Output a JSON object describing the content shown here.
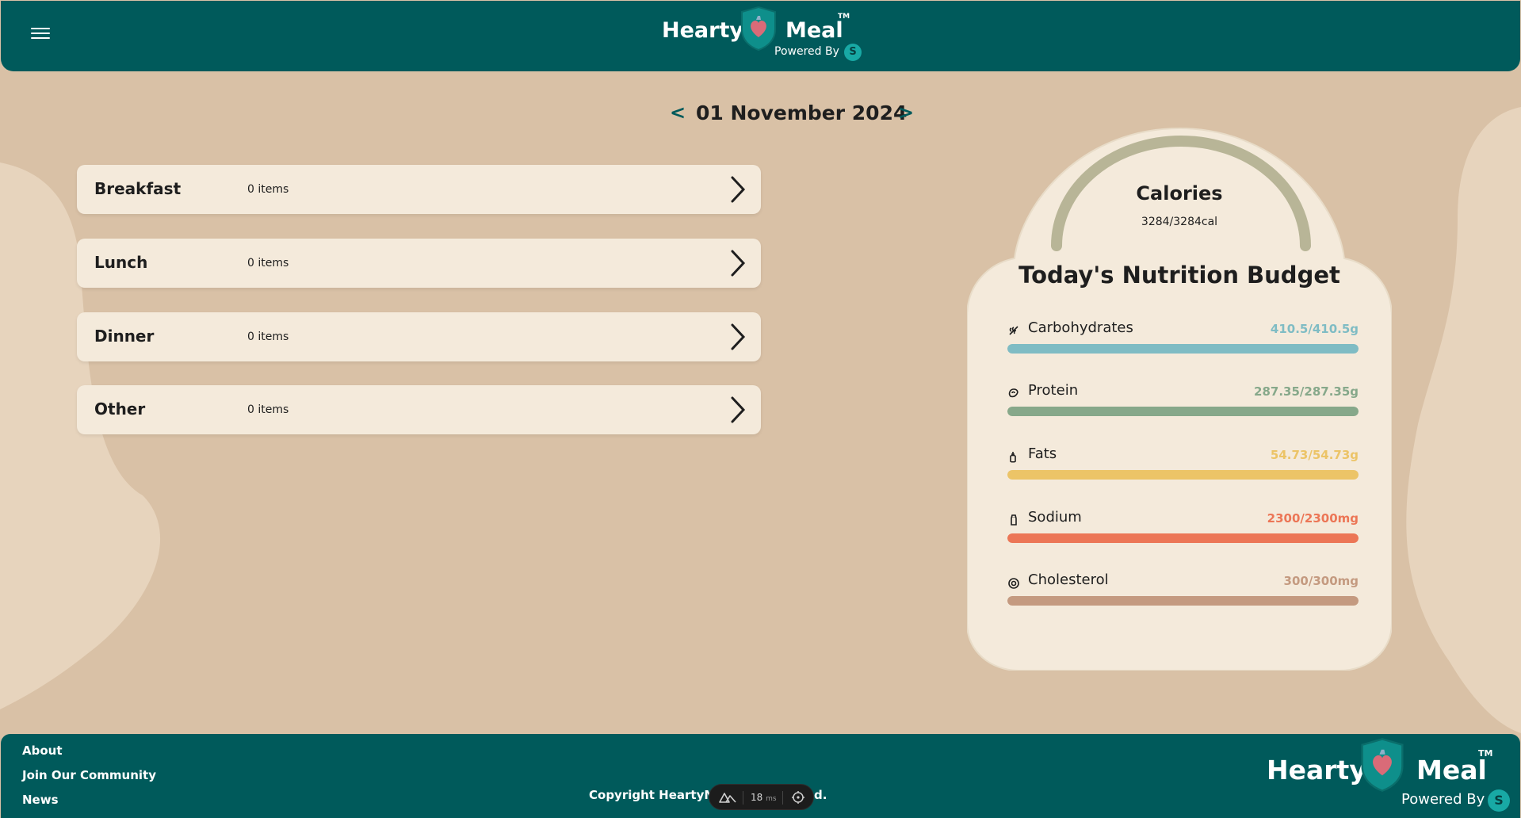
{
  "brand": {
    "word1": "Hearty",
    "word2": "Meal",
    "tm": "TM",
    "powered_by": "Powered By",
    "badge_letter": "S"
  },
  "date_nav": {
    "prev": "<",
    "date": "01 November 2024",
    "next": ">"
  },
  "meals": [
    {
      "name": "Breakfast",
      "count": "0 items"
    },
    {
      "name": "Lunch",
      "count": "0 items"
    },
    {
      "name": "Dinner",
      "count": "0 items"
    },
    {
      "name": "Other",
      "count": "0 items"
    }
  ],
  "calories": {
    "title": "Calories",
    "value": "3284/3284cal",
    "progress": 1.0
  },
  "budget": {
    "title": "Today's Nutrition Budget",
    "nutrients": [
      {
        "label": "Carbohydrates",
        "value": "410.5/410.5g",
        "progress": 1.0,
        "color": "#7fbcc4",
        "icon": "grain-icon"
      },
      {
        "label": "Protein",
        "value": "287.35/287.35g",
        "progress": 1.0,
        "color": "#86a88a",
        "icon": "meat-icon"
      },
      {
        "label": "Fats",
        "value": "54.73/54.73g",
        "progress": 1.0,
        "color": "#ecc467",
        "icon": "oil-drop-icon"
      },
      {
        "label": "Sodium",
        "value": "2300/2300mg",
        "progress": 1.0,
        "color": "#ec7656",
        "icon": "salt-shaker-icon"
      },
      {
        "label": "Cholesterol",
        "value": "300/300mg",
        "progress": 1.0,
        "color": "#c49a80",
        "icon": "egg-icon"
      }
    ]
  },
  "footer": {
    "links": [
      "About",
      "Join Our Community",
      "News"
    ],
    "copyright": "Copyright HeartyMea",
    "copyright_tail": "d."
  },
  "dev_indicator": {
    "value": "18",
    "unit": "ms"
  },
  "colors": {
    "primary": "#005a5b",
    "background": "#d9c1a6",
    "card": "#f4eadb",
    "gauge": "#b8b597"
  }
}
